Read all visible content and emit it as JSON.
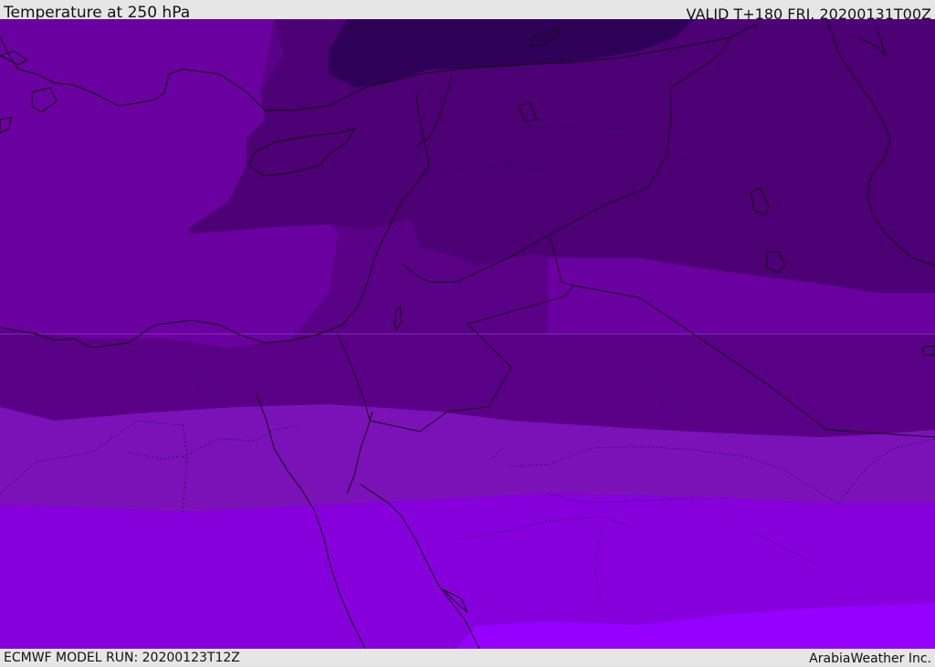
{
  "header": {
    "title": "Temperature at 250 hPa",
    "valid": "VALID T+180 FRI. 20200131T00Z"
  },
  "footer": {
    "model_run": "ECMWF MODEL RUN: 20200123T12Z",
    "credit": "ArabiaWeather Inc."
  },
  "map": {
    "colors": {
      "band_coldest": "#2e0058",
      "band_1": "#4c0074",
      "band_2": "#5a0086",
      "band_3": "#6a00a0",
      "band_4": "#7a12b8",
      "band_5": "#8600dc",
      "band_6": "#9500ff"
    },
    "features": [
      "coastlines",
      "country-borders",
      "province-borders",
      "gridline"
    ]
  }
}
